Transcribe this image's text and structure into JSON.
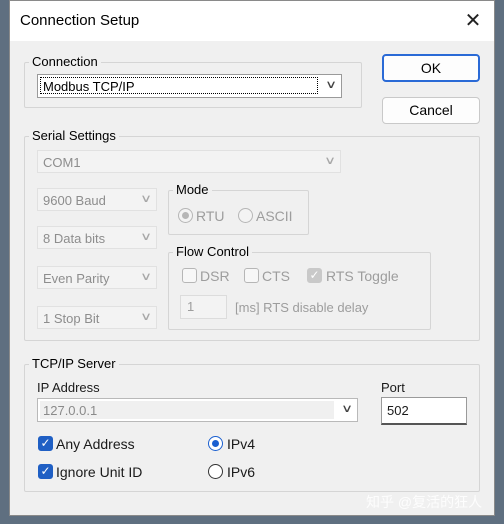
{
  "window": {
    "title": "Connection Setup"
  },
  "buttons": {
    "ok": "OK",
    "cancel": "Cancel"
  },
  "connection": {
    "legend": "Connection",
    "value": "Modbus TCP/IP"
  },
  "serial": {
    "legend": "Serial Settings",
    "port": "COM1",
    "baud": "9600 Baud",
    "data_bits": "8 Data bits",
    "parity": "Even Parity",
    "stop_bits": "1 Stop Bit",
    "mode": {
      "legend": "Mode",
      "rtu": "RTU",
      "ascii": "ASCII",
      "selected": "RTU"
    },
    "flow": {
      "legend": "Flow Control",
      "dsr": "DSR",
      "cts": "CTS",
      "rts_toggle": "RTS Toggle",
      "rts_toggle_checked": true,
      "delay_value": "1",
      "delay_label": "[ms] RTS disable delay"
    }
  },
  "tcp": {
    "legend": "TCP/IP Server",
    "ip_label": "IP Address",
    "ip_value": "127.0.0.1",
    "port_label": "Port",
    "port_value": "502",
    "any_address": "Any Address",
    "any_address_checked": true,
    "ignore_unit_id": "Ignore Unit ID",
    "ignore_unit_id_checked": true,
    "ipv4": "IPv4",
    "ipv6": "IPv6",
    "selected_ip_version": "IPv4"
  },
  "icons": {
    "close": "close-icon",
    "chevron": "chevron-down-icon",
    "check": "checkmark-icon"
  },
  "watermark": "知乎 @复活的狂人",
  "colors": {
    "accent": "#1f5fc4",
    "default_button_border": "#2a6ad6",
    "disabled_text": "#9d9d9d"
  }
}
